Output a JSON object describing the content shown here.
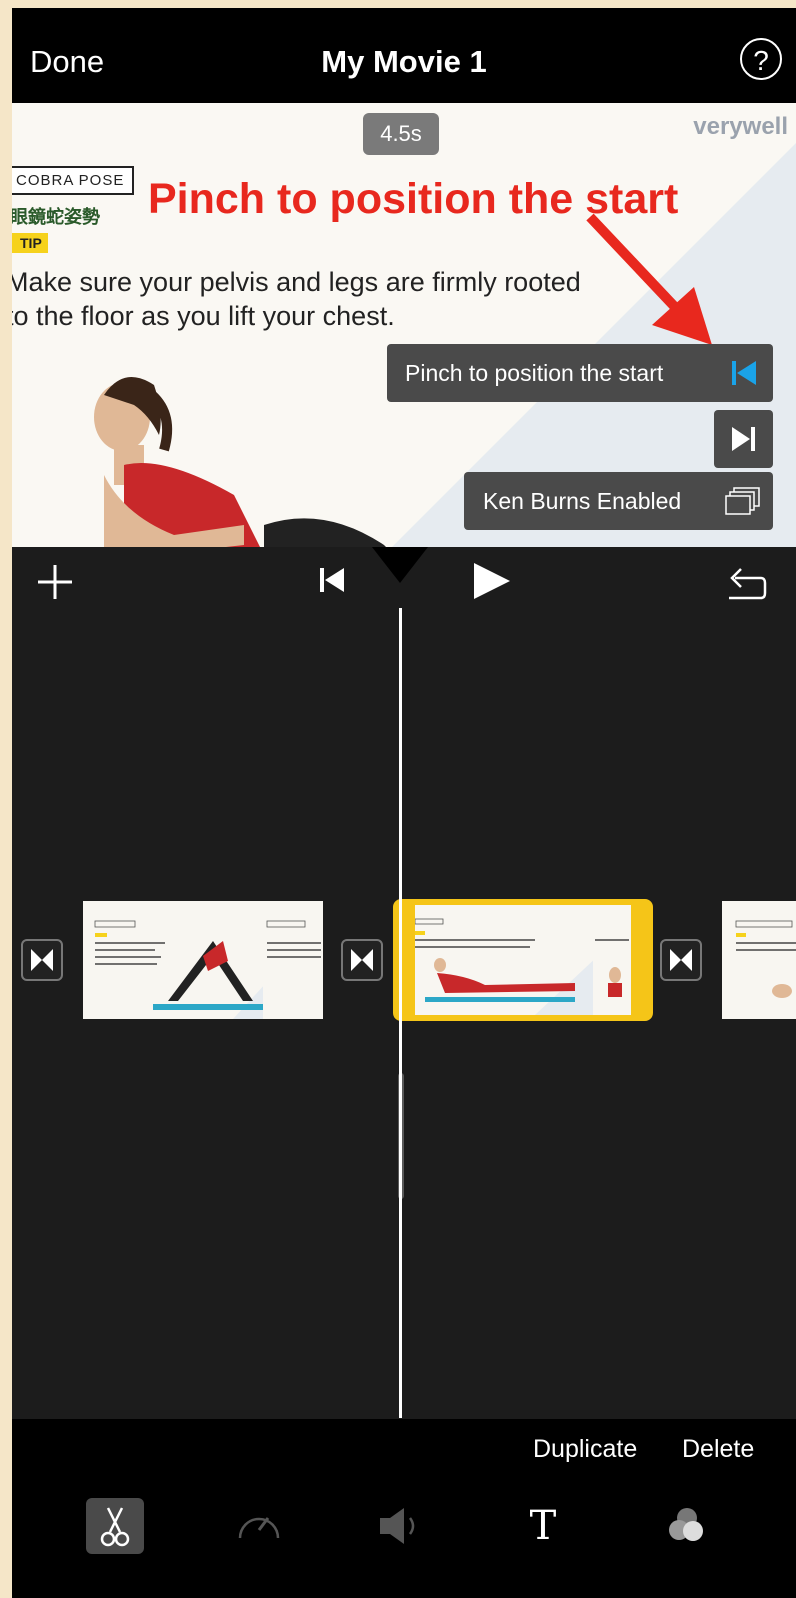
{
  "nav": {
    "done_label": "Done",
    "title": "My Movie 1",
    "help_label": "?"
  },
  "preview": {
    "duration": "4.5s",
    "brand": "verywell",
    "pose_label": "COBRA POSE",
    "pose_cn": "眼鏡蛇姿勢",
    "tip_label": "TIP",
    "tip_text": "Make sure your pelvis and legs are firmly rooted to the floor as you lift your chest.",
    "annotation": "Pinch to position the start",
    "hint_label": "Pinch to position the start",
    "ken_burns_label": "Ken Burns Enabled"
  },
  "toolbar": {
    "add_icon": "plus-icon",
    "skip_start_icon": "skip-to-start-icon",
    "play_icon": "play-icon",
    "undo_icon": "undo-icon"
  },
  "timeline": {
    "clips": [
      {
        "pose": "DOWNWARD DOG",
        "text": "Keep both toes pointed towards the front of your mat and sink your heels toward the floor.",
        "brand": "verywell"
      },
      {
        "pose": "COBRA POSE",
        "text": "Make sure your pelvis and legs are firmly rooted to the floor as you lift your chest.",
        "brand": "verywell",
        "selected": true
      },
      {
        "pose": "RECLINED GODDESS POSE",
        "text": "Breathe naturally in this pose. Allow your",
        "brand": "verywell"
      }
    ]
  },
  "actions": {
    "duplicate_label": "Duplicate",
    "delete_label": "Delete"
  },
  "tabs": [
    {
      "name": "scissors-icon",
      "active": true
    },
    {
      "name": "speed-icon",
      "active": false
    },
    {
      "name": "volume-icon",
      "active": false
    },
    {
      "name": "title-text-icon",
      "label": "T",
      "active": false
    },
    {
      "name": "filters-icon",
      "active": false
    }
  ],
  "colors": {
    "accent_blue": "#1aa3e8",
    "selection_yellow": "#f5c518",
    "annotation_red": "#e8281e"
  }
}
